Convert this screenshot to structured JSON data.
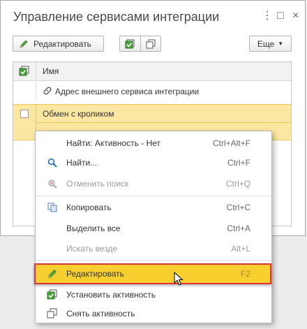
{
  "window": {
    "title": "Управление сервисами интеграции"
  },
  "toolbar": {
    "edit_label": "Редактировать",
    "more_label": "Еще"
  },
  "grid": {
    "header": "Имя",
    "rows": [
      {
        "name": "Адрес внешнего сервиса интеграции"
      },
      {
        "name": "Обмен с кроликом"
      }
    ]
  },
  "context_menu": {
    "items": [
      {
        "label": "Найти: Активность - Нет",
        "shortcut": "Ctrl+Alt+F"
      },
      {
        "label": "Найти...",
        "shortcut": "Ctrl+F"
      },
      {
        "label": "Отменить поиск",
        "shortcut": "Ctrl+Q"
      },
      {
        "label": "Копировать",
        "shortcut": "Ctrl+C"
      },
      {
        "label": "Выделить все",
        "shortcut": "Ctrl+A"
      },
      {
        "label": "Искать везде",
        "shortcut": "Alt+L"
      },
      {
        "label": "Редактировать",
        "shortcut": "F2"
      },
      {
        "label": "Установить активность",
        "shortcut": ""
      },
      {
        "label": "Снять активность",
        "shortcut": ""
      }
    ]
  },
  "colors": {
    "selection": "#fbe7a1",
    "highlight": "#f7cf2e",
    "highlight_border": "#e0323a",
    "accent_green": "#3e9a2f"
  }
}
